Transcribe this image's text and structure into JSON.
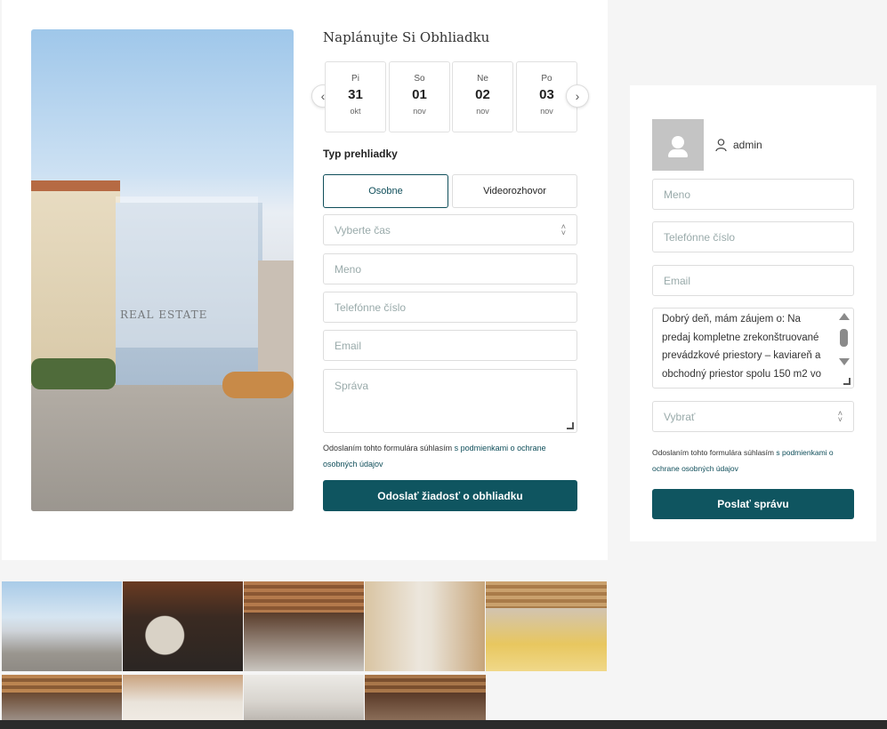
{
  "schedule": {
    "title": "Naplánujte Si Obhliadku",
    "days": [
      {
        "name": "Pi",
        "date": "31",
        "month": "okt"
      },
      {
        "name": "So",
        "date": "01",
        "month": "nov"
      },
      {
        "name": "Ne",
        "date": "02",
        "month": "nov"
      },
      {
        "name": "Po",
        "date": "03",
        "month": "nov"
      }
    ],
    "tour_type_label": "Typ prehliadky",
    "tour_types": [
      "Osobne",
      "Videorozhovor"
    ],
    "time_placeholder": "Vyberte čas",
    "name_placeholder": "Meno",
    "phone_placeholder": "Telefónne číslo",
    "email_placeholder": "Email",
    "message_placeholder": "Správa",
    "consent_text": "Odoslaním tohto formulára súhlasím",
    "consent_link": "s podmienkami o ochrane osobných údajov",
    "submit_label": "Odoslať žiadosť o obhliadku",
    "hero_watermark": "REAL ESTATE"
  },
  "contact": {
    "agent_name": "admin",
    "name_placeholder": "Meno",
    "phone_placeholder": "Telefónne číslo",
    "email_placeholder": "Email",
    "message_value": "Dobrý deň, mám záujem o: Na predaj kompletne zrekonštruované prevádzkové priestory – kaviareň a obchodný priestor spolu 150 m2 vo",
    "select_placeholder": "Vybrať",
    "consent_text": "Odoslaním tohto formulára súhlasím",
    "consent_link": "s podmienkami o ochrane osobných údajov",
    "submit_label": "Poslať správu"
  },
  "colors": {
    "accent": "#0f5560",
    "border": "#dddddd",
    "page_bg": "#f5f5f5"
  }
}
